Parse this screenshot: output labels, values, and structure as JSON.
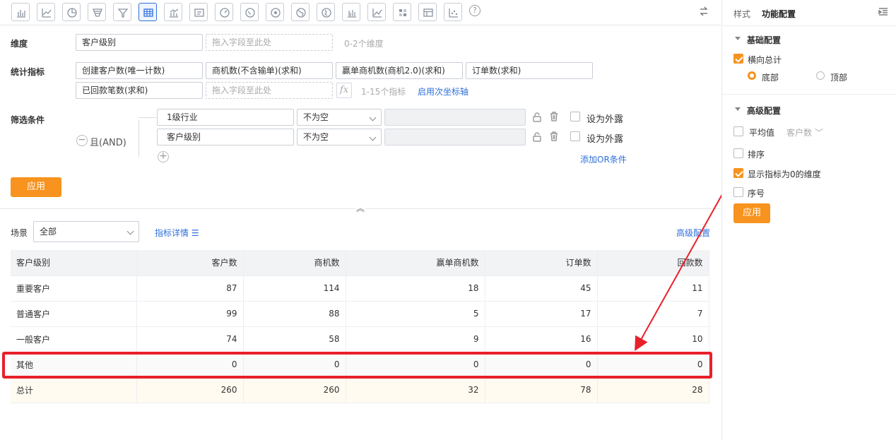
{
  "toolbar": {
    "icons": [
      "bar-chart-icon",
      "line-chart-icon",
      "pie-chart-icon",
      "funnel-icon",
      "funnel-alt-icon",
      "table-icon",
      "combo-chart-icon",
      "indicator-card-icon",
      "gauge-icon",
      "map-icon",
      "map-alt-icon",
      "globe-icon",
      "globe-alt-icon",
      "column-chart-icon",
      "area-chart-icon",
      "heatmap-icon",
      "detail-table-icon",
      "scatter-icon",
      "help-icon"
    ],
    "active_index": 5,
    "help_symbol": "?"
  },
  "config": {
    "dimension_label": "维度",
    "dimension_field": "客户级别",
    "dimension_drop_placeholder": "拖入字段至此处",
    "dimension_hint": "0-2个维度",
    "metrics_label": "统计指标",
    "metrics": [
      "创建客户数(唯一计数)",
      "商机数(不含输单)(求和)",
      "赢单商机数(商机2.0)(求和)",
      "订单数(求和)",
      "已回款笔数(求和)"
    ],
    "metrics_drop_placeholder": "拖入字段至此处",
    "fx_symbol": "fx",
    "metrics_hint": "1-15个指标",
    "secondary_axis_link": "启用次坐标轴",
    "filter_label": "筛选条件",
    "filter_logic": "且(AND)",
    "filters": [
      {
        "field": "1级行业",
        "op": "不为空",
        "expose_label": "设为外露"
      },
      {
        "field": "客户级别",
        "op": "不为空",
        "expose_label": "设为外露"
      }
    ],
    "add_or_link": "添加OR条件",
    "apply_button": "应用"
  },
  "report": {
    "scene_label": "场景",
    "scene_value": "全部",
    "metric_details_link": "指标详情",
    "advanced_config_link": "高级配置",
    "columns": [
      "客户级别",
      "客户数",
      "商机数",
      "赢单商机数",
      "订单数",
      "回款数"
    ],
    "rows": [
      [
        "重要客户",
        "87",
        "114",
        "18",
        "45",
        "11"
      ],
      [
        "普通客户",
        "99",
        "88",
        "5",
        "17",
        "7"
      ],
      [
        "一般客户",
        "74",
        "58",
        "9",
        "16",
        "10"
      ],
      [
        "其他",
        "0",
        "0",
        "0",
        "0",
        "0"
      ]
    ],
    "total_row": [
      "总计",
      "260",
      "260",
      "32",
      "78",
      "28"
    ],
    "highlight_color": "#e8202a"
  },
  "panel": {
    "tab_style": "样式",
    "tab_function": "功能配置",
    "basic_section": "基础配置",
    "horizontal_total": "横向总计",
    "position_bottom": "底部",
    "position_top": "顶部",
    "advanced_section": "高级配置",
    "average": "平均值",
    "average_metric": "客户数",
    "sort": "排序",
    "show_zero_dims": "显示指标为0的维度",
    "serial_no": "序号",
    "apply_button": "应用",
    "accent": "#f7931e"
  }
}
